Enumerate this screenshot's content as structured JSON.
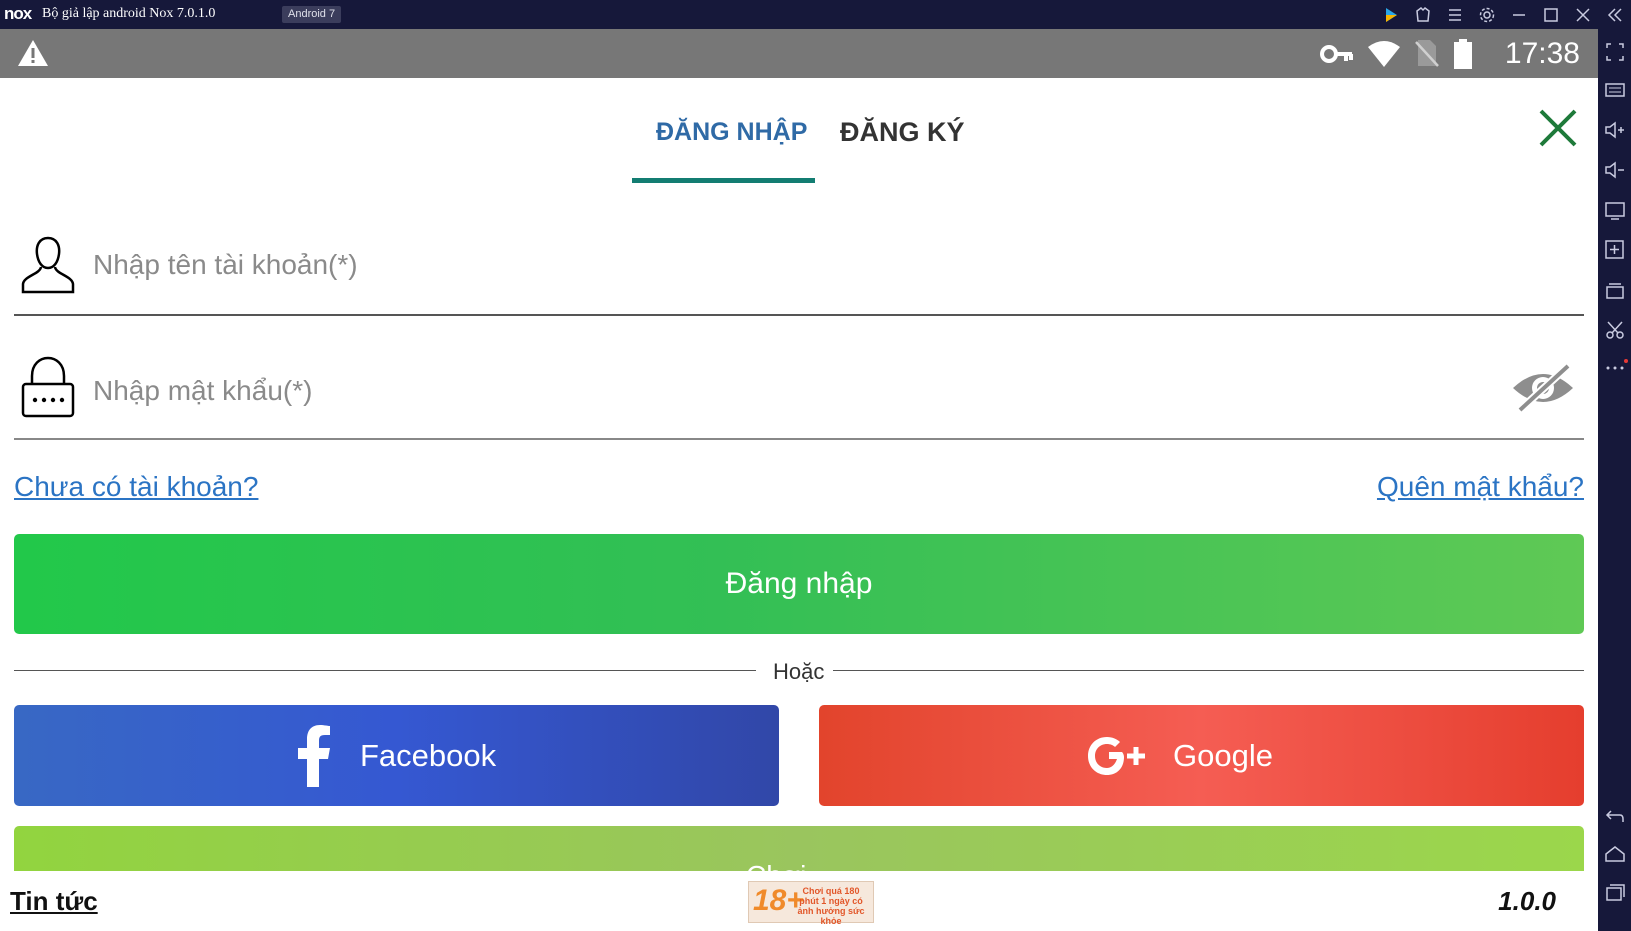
{
  "titlebar": {
    "logo": "nox",
    "title": "Bộ giả lập android Nox 7.0.1.0",
    "badge": "Android 7"
  },
  "statusbar": {
    "time": "17:38"
  },
  "tabs": [
    {
      "label": "ĐĂNG NHẬP",
      "active": true
    },
    {
      "label": "ĐĂNG KÝ",
      "active": false
    }
  ],
  "form": {
    "username_placeholder": "Nhập tên tài khoản(*)",
    "username_value": "",
    "password_placeholder": "Nhập mật khẩu(*)",
    "password_value": "",
    "no_account_link": "Chưa có tài khoản?",
    "forgot_link": "Quên mật khẩu?",
    "login_button": "Đăng nhập",
    "or_text": "Hoặc",
    "facebook_button": "Facebook",
    "google_button": "Google",
    "play_button": "Chơi"
  },
  "footer": {
    "news": "Tin tức",
    "rating_age": "18+",
    "rating_text": "Chơi quá 180 phút 1 ngày có ảnh hưởng sức khỏe",
    "version": "1.0.0"
  },
  "colors": {
    "tab_active": "#2f6aa6",
    "tab_indicator": "#137d72",
    "login_green": "#22c84a",
    "facebook_blue": "#3558d2",
    "google_red": "#f55d53",
    "link_blue": "#2b74c4"
  }
}
